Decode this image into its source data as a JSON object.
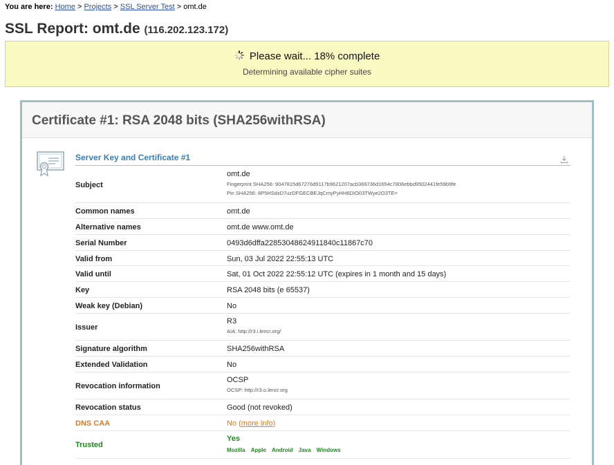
{
  "breadcrumb": {
    "label": "You are here:",
    "items": [
      "Home",
      "Projects",
      "SSL Server Test"
    ],
    "current": "omt.de",
    "separator": ">"
  },
  "title": {
    "text": "SSL Report: omt.de",
    "ip": "(116.202.123.172)"
  },
  "progress": {
    "main": "Please wait... 18% complete",
    "sub": "Determining available cipher suites",
    "percent": 18
  },
  "certificate": {
    "header": "Certificate #1: RSA 2048 bits (SHA256withRSA)",
    "section_title": "Server Key and Certificate #1",
    "rows": [
      {
        "key": "Subject",
        "value": "omt.de",
        "extra": [
          "Fingerprint SHA256: 9047815d67276d9117b9621207acb369736d1654c7806ebbd9502441fe59b9fe",
          "Pin SHA256: 8P5HSdxD7uzDFGECBEJqCmyPyHH6DIO03TWye2O3TE="
        ]
      },
      {
        "key": "Common names",
        "value": "omt.de"
      },
      {
        "key": "Alternative names",
        "value": "omt.de www.omt.de"
      },
      {
        "key": "Serial Number",
        "value": "0493d6dffa22853048624911840c11867c70"
      },
      {
        "key": "Valid from",
        "value": "Sun, 03 Jul 2022 22:55:13 UTC"
      },
      {
        "key": "Valid until",
        "value": "Sat, 01 Oct 2022 22:55:12 UTC (expires in 1 month and 15 days)"
      },
      {
        "key": "Key",
        "value": "RSA 2048 bits (e 65537)"
      },
      {
        "key": "Weak key (Debian)",
        "value": "No"
      },
      {
        "key": "Issuer",
        "value": "R3",
        "extra": [
          "AIA: http://r3.i.lencr.org/"
        ]
      },
      {
        "key": "Signature algorithm",
        "value": "SHA256withRSA"
      },
      {
        "key": "Extended Validation",
        "value": "No"
      },
      {
        "key": "Revocation information",
        "value": "OCSP",
        "extra": [
          "OCSP: http://r3.o.lencr.org"
        ]
      },
      {
        "key": "Revocation status",
        "value": "Good (not revoked)"
      },
      {
        "key": "DNS CAA",
        "value": "No",
        "link": "more info"
      },
      {
        "key": "Trusted",
        "value": "Yes",
        "platforms": [
          "Mozilla",
          "Apple",
          "Android",
          "Java",
          "Windows"
        ]
      }
    ]
  },
  "colors": {
    "link": "#2850b0",
    "warning": "#e07a20",
    "ok": "#1d8a1d",
    "section": "#3a7fb5",
    "panel_border": "#9cc0c3"
  },
  "icons": {
    "spinner": "spinner-icon",
    "certificate": "certificate-icon",
    "download": "download-icon"
  }
}
